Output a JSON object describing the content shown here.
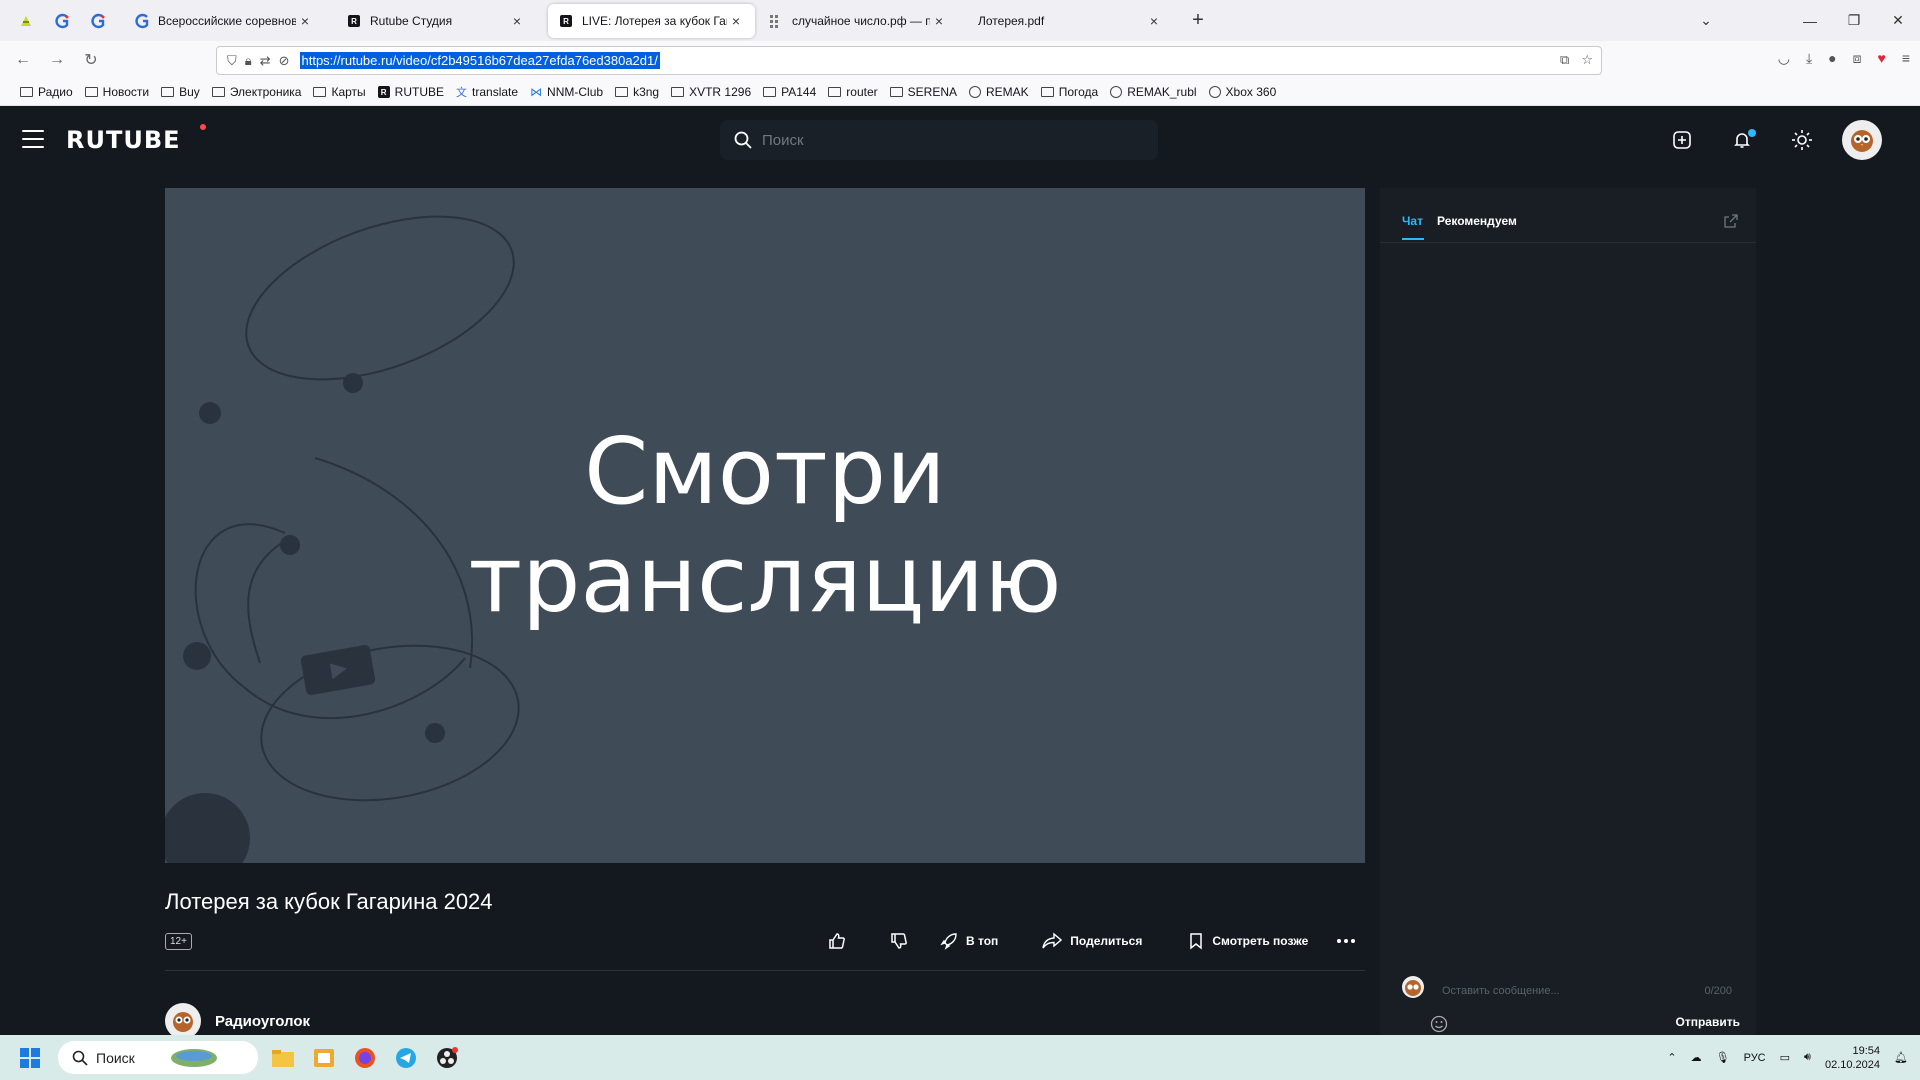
{
  "browser": {
    "tabs": [
      {
        "title": "Всероссийские соревнования",
        "active": false
      },
      {
        "title": "Rutube Студия",
        "active": false
      },
      {
        "title": "LIVE: Лотерея за кубок Гагарина",
        "active": true
      },
      {
        "title": "случайное число.рф — просто",
        "active": false
      },
      {
        "title": "Лотерея.pdf",
        "active": false
      }
    ],
    "tab_close_glyph": "×",
    "new_tab_glyph": "+",
    "url": "https://rutube.ru/video/cf2b49516b67dea27efda76ed380a2d1/",
    "bookmarks": [
      {
        "label": "Радио",
        "icon": "folder-icon"
      },
      {
        "label": "Новости",
        "icon": "folder-icon"
      },
      {
        "label": "Buy",
        "icon": "folder-icon"
      },
      {
        "label": "Электроника",
        "icon": "folder-icon"
      },
      {
        "label": "Карты",
        "icon": "folder-icon"
      },
      {
        "label": "RUTUBE",
        "icon": "rutube-icon"
      },
      {
        "label": "translate",
        "icon": "translate-icon"
      },
      {
        "label": "NNM-Club",
        "icon": "nnm-icon"
      },
      {
        "label": "k3ng",
        "icon": "folder-icon"
      },
      {
        "label": "XVTR 1296",
        "icon": "folder-icon"
      },
      {
        "label": "PA144",
        "icon": "folder-icon"
      },
      {
        "label": "router",
        "icon": "folder-icon"
      },
      {
        "label": "SERENA",
        "icon": "folder-icon"
      },
      {
        "label": "REMAK",
        "icon": "globe-icon"
      },
      {
        "label": "Погода",
        "icon": "folder-icon"
      },
      {
        "label": "REMAK_rubl",
        "icon": "globe-icon"
      },
      {
        "label": "Xbox 360",
        "icon": "globe-icon"
      }
    ]
  },
  "rutube": {
    "logo": "RUTUBE",
    "search_placeholder": "Поиск",
    "player_text_line1": "Смотри",
    "player_text_line2": "трансляцию",
    "video_title": "Лотерея за кубок Гагарина 2024",
    "age_rating": "12+",
    "actions": {
      "to_top": "В топ",
      "share": "Поделиться",
      "watch_later": "Смотреть позже"
    },
    "channel_name": "Радиоуголок",
    "chat": {
      "tab_chat": "Чат",
      "tab_recommended": "Рекомендуем",
      "input_placeholder": "Оставить сообщение...",
      "counter": "0/200",
      "send_label": "Отправить"
    },
    "accent_color": "#2fb6ff"
  },
  "taskbar": {
    "search_placeholder": "Поиск",
    "language": "РУС",
    "time": "19:54",
    "date": "02.10.2024"
  }
}
